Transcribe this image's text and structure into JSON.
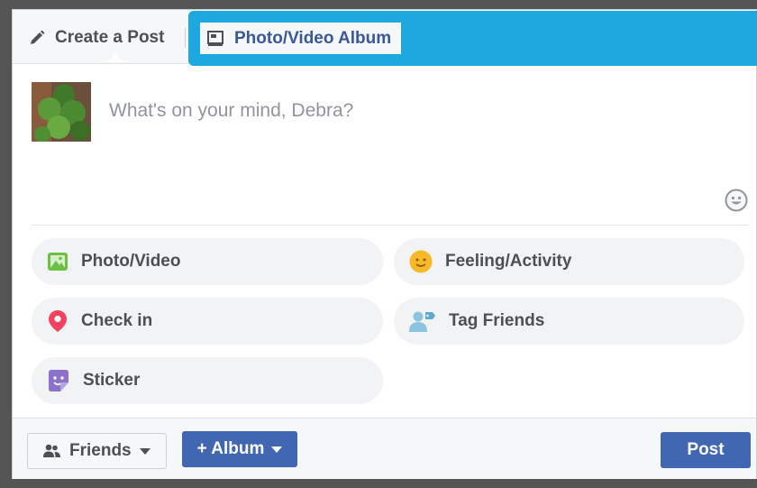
{
  "tabs": {
    "create_post": "Create a Post",
    "photo_video_album": "Photo/Video Album"
  },
  "composer": {
    "placeholder": "What's on your mind, Debra?"
  },
  "options": {
    "photo_video": "Photo/Video",
    "feeling_activity": "Feeling/Activity",
    "check_in": "Check in",
    "tag_friends": "Tag Friends",
    "sticker": "Sticker"
  },
  "footer": {
    "audience": "Friends",
    "album": "+ Album",
    "post": "Post"
  },
  "colors": {
    "highlight": "#1da8e0",
    "brand_blue": "#4267b2",
    "link_blue": "#385898"
  },
  "icons": {
    "create_post": "pencil-icon",
    "album": "photo-album-icon",
    "emoji": "emoji-icon",
    "photo": "photo-icon",
    "feeling": "smiley-icon",
    "check_in": "location-pin-icon",
    "tag_friends": "tag-friends-icon",
    "sticker": "sticker-icon",
    "audience": "friends-icon"
  }
}
